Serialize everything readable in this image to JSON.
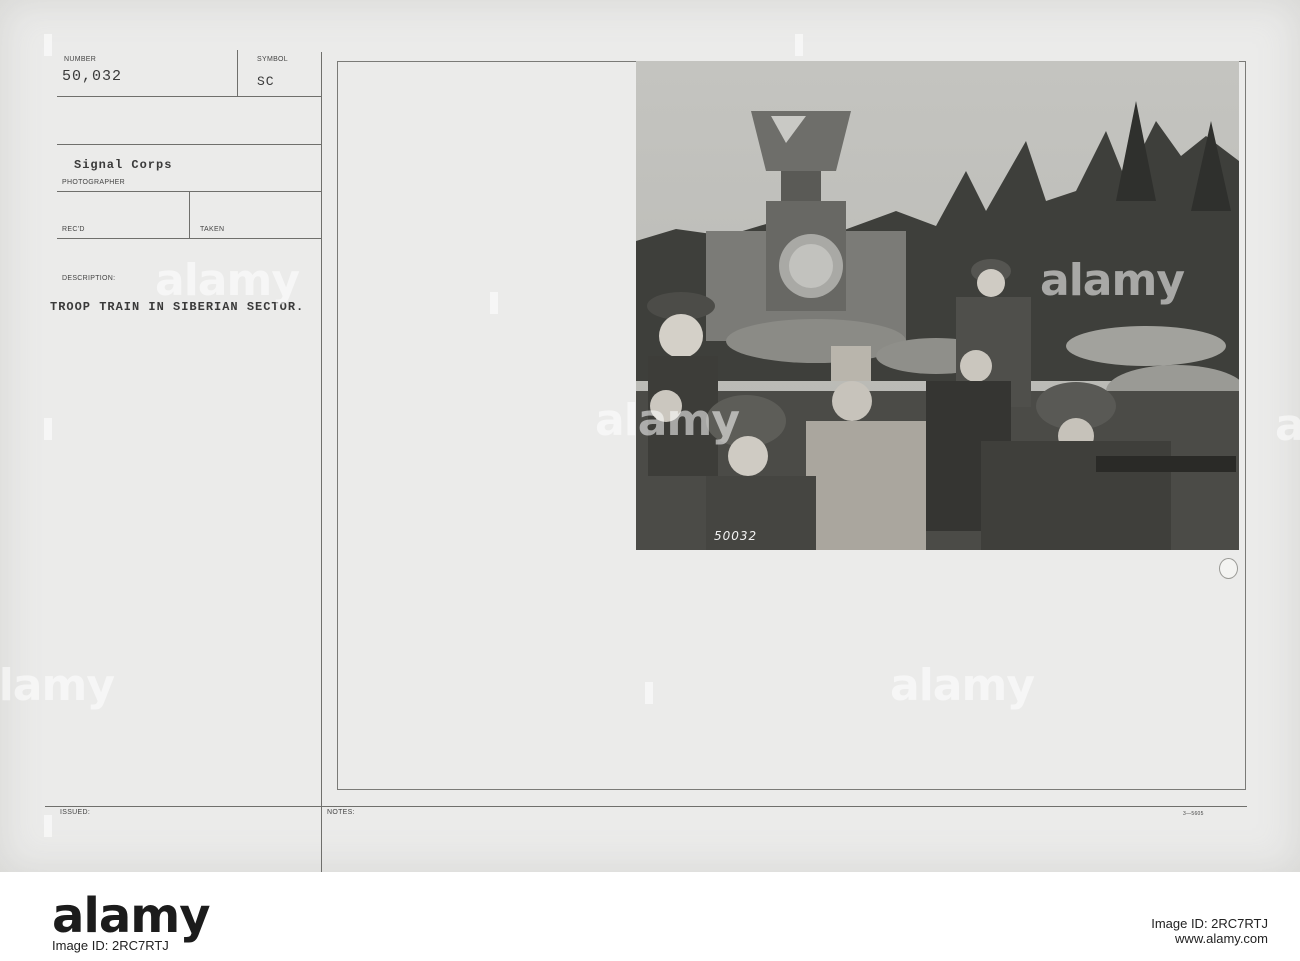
{
  "card": {
    "number_label": "NUMBER",
    "number_value": "50,032",
    "symbol_label": "SYMBOL",
    "symbol_value": "SC",
    "photographer_value": "Signal Corps",
    "photographer_label": "PHOTOGRAPHER",
    "recd_label": "REC'D",
    "taken_label": "TAKEN",
    "description_label": "DESCRIPTION:",
    "description_value": "TROOP TRAIN IN SIBERIAN SECTOR.",
    "issued_label": "ISSUED:",
    "notes_label": "NOTES:",
    "form_code": "3—5605"
  },
  "photo": {
    "negative_number": "50032"
  },
  "watermark": {
    "text": "alamy"
  },
  "footer": {
    "logo": "alamy",
    "image_id": "Image ID: 2RC7RTJ",
    "site": "www.alamy.com"
  }
}
